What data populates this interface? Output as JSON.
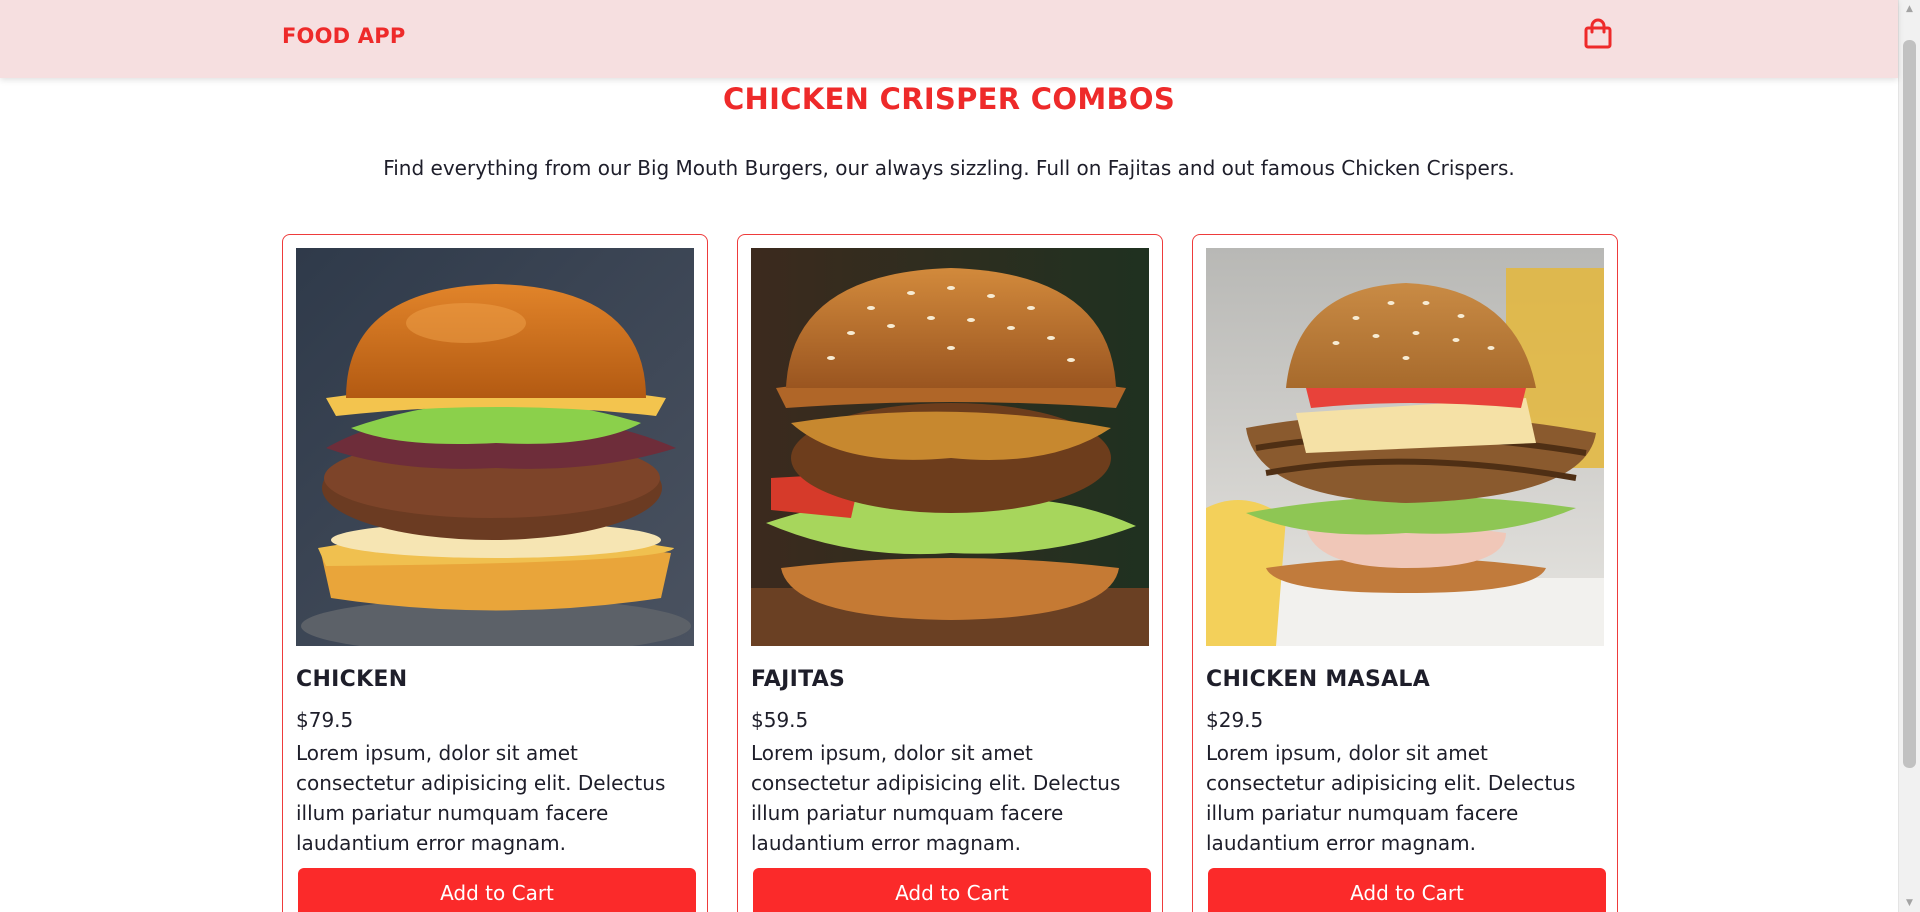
{
  "header": {
    "brand": "FOOD APP",
    "cart_icon": "shopping-bag-icon",
    "accent_color": "#ee2a2a",
    "background_color": "#f6dfe0"
  },
  "main": {
    "title": "CHICKEN CRISPER COMBOS",
    "description": "Find everything from our Big Mouth Burgers, our always sizzling. Full on Fajitas and out famous Chicken Crispers."
  },
  "products": [
    {
      "name": "CHICKEN",
      "price": "$79.5",
      "description": "Lorem ipsum, dolor sit amet consectetur adipisicing elit. Delectus illum pariatur numquam facere laudantium error magnam.",
      "button_label": "Add to Cart",
      "image": "burger-with-onions-photo"
    },
    {
      "name": "FAJITAS",
      "price": "$59.5",
      "description": "Lorem ipsum, dolor sit amet consectetur adipisicing elit. Delectus illum pariatur numquam facere laudantium error magnam.",
      "button_label": "Add to Cart",
      "image": "sesame-burger-photo"
    },
    {
      "name": "CHICKEN MASALA",
      "price": "$29.5",
      "description": "Lorem ipsum, dolor sit amet consectetur adipisicing elit. Delectus illum pariatur numquam facere laudantium error magnam.",
      "button_label": "Add to Cart",
      "image": "grilled-chicken-burger-photo"
    }
  ],
  "colors": {
    "button": "#fb2a2a",
    "card_border": "#ee3b3b"
  }
}
